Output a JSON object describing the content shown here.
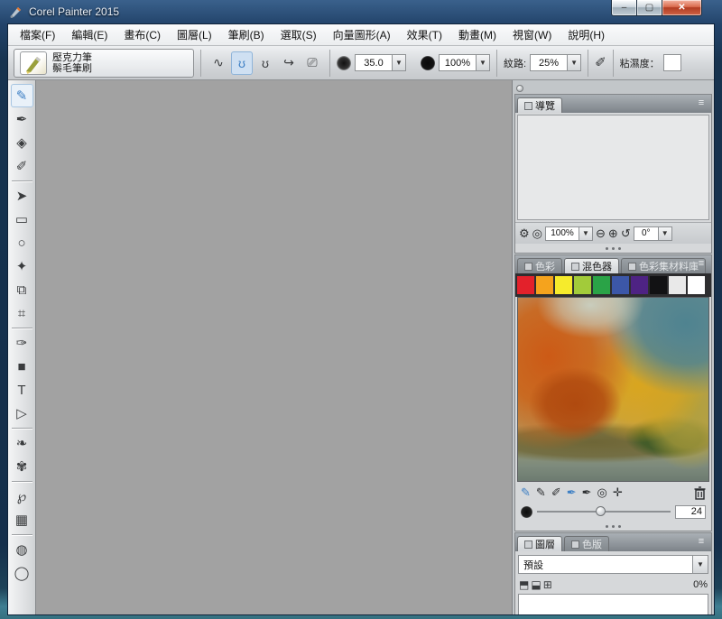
{
  "window": {
    "title": "Corel Painter 2015",
    "minimize_label": "–",
    "maximize_label": "▢",
    "close_label": "✕"
  },
  "menu_items": [
    {
      "name": "file",
      "label": "檔案(F)"
    },
    {
      "name": "edit",
      "label": "編輯(E)"
    },
    {
      "name": "canvas",
      "label": "畫布(C)"
    },
    {
      "name": "layers",
      "label": "圖層(L)"
    },
    {
      "name": "brushes",
      "label": "筆刷(B)"
    },
    {
      "name": "select",
      "label": "選取(S)"
    },
    {
      "name": "shapes",
      "label": "向量圖形(A)"
    },
    {
      "name": "effects",
      "label": "效果(T)"
    },
    {
      "name": "movie",
      "label": "動畫(M)"
    },
    {
      "name": "window",
      "label": "視窗(W)"
    },
    {
      "name": "help",
      "label": "說明(H)"
    }
  ],
  "property_bar": {
    "brush_category": "壓克力筆",
    "brush_variant": "鬃毛筆刷",
    "size_value": "35.0",
    "opacity_value": "100%",
    "grain_label": "紋路:",
    "grain_value": "25%",
    "viscosity_label": "粘濕度："
  },
  "stroke_buttons": [
    {
      "name": "freehand-stroke",
      "glyph": "∿",
      "selected": false
    },
    {
      "name": "loop-stroke-a",
      "glyph": "ʊ",
      "selected": true
    },
    {
      "name": "loop-stroke-b",
      "glyph": "ʊ",
      "selected": false
    },
    {
      "name": "align-to-path",
      "glyph": "↪",
      "selected": false
    },
    {
      "name": "perspective-guides",
      "glyph": "⎚",
      "selected": false
    }
  ],
  "toolbox": [
    {
      "type": "tool",
      "name": "brush-tool",
      "glyph": "✎",
      "selected": true
    },
    {
      "type": "tool",
      "name": "dropper-tool",
      "glyph": "✒",
      "selected": false
    },
    {
      "type": "tool",
      "name": "paint-bucket-tool",
      "glyph": "◈",
      "selected": false
    },
    {
      "type": "tool",
      "name": "eraser-tool",
      "glyph": "✐",
      "selected": false
    },
    {
      "type": "divider"
    },
    {
      "type": "tool",
      "name": "layer-adjuster-tool",
      "glyph": "➤",
      "selected": false
    },
    {
      "type": "tool",
      "name": "rectangular-selection-tool",
      "glyph": "▭",
      "selected": false
    },
    {
      "type": "tool",
      "name": "lasso-tool",
      "glyph": "○",
      "selected": false
    },
    {
      "type": "tool",
      "name": "magic-wand-tool",
      "glyph": "✦",
      "selected": false
    },
    {
      "type": "tool",
      "name": "transform-tool",
      "glyph": "⧉",
      "selected": false
    },
    {
      "type": "tool",
      "name": "crop-tool",
      "glyph": "⌗",
      "selected": false
    },
    {
      "type": "divider"
    },
    {
      "type": "tool",
      "name": "pen-tool",
      "glyph": "✑",
      "selected": false
    },
    {
      "type": "tool",
      "name": "rectangular-shape-tool",
      "glyph": "■",
      "selected": false
    },
    {
      "type": "tool",
      "name": "text-tool",
      "glyph": "T",
      "selected": false
    },
    {
      "type": "tool",
      "name": "shape-selection-tool",
      "glyph": "▷",
      "selected": false
    },
    {
      "type": "divider"
    },
    {
      "type": "tool",
      "name": "mirror-painting-tool",
      "glyph": "❧",
      "selected": false
    },
    {
      "type": "tool",
      "name": "kaleidoscope-tool",
      "glyph": "✾",
      "selected": false
    },
    {
      "type": "divider"
    },
    {
      "type": "tool",
      "name": "divine-proportion-tool",
      "glyph": "℘",
      "selected": false
    },
    {
      "type": "tool",
      "name": "layout-grid-tool",
      "glyph": "▦",
      "selected": false
    },
    {
      "type": "divider"
    },
    {
      "type": "tool",
      "name": "magnifier-tool",
      "glyph": "◍",
      "selected": false
    },
    {
      "type": "tool",
      "name": "grabber-tool",
      "glyph": "◯",
      "selected": false
    }
  ],
  "navigator": {
    "tab_label": "導覽",
    "zoom_value": "100%",
    "rotation_value": "0°",
    "icons": {
      "settings": "⚙",
      "magnifier": "◎",
      "zoom_out": "⊖",
      "zoom_in": "⊕",
      "rotate": "↺"
    }
  },
  "color_panel": {
    "tabs": [
      {
        "name": "color",
        "label": "色彩",
        "active": false
      },
      {
        "name": "mixer",
        "label": "混色器",
        "active": true
      },
      {
        "name": "color-set-library",
        "label": "色彩集材料庫",
        "active": false
      }
    ],
    "swatches": [
      "#e3212b",
      "#f5a31d",
      "#f6eb2c",
      "#a2cb3a",
      "#2aa347",
      "#3c57a8",
      "#4e2383",
      "#121214",
      "#e9e9e9",
      "#ffffff"
    ],
    "mixer_tools": [
      {
        "name": "dirty-brush-mode-icon",
        "glyph": "✎",
        "blue": true
      },
      {
        "name": "apply-color-icon",
        "glyph": "✎",
        "blue": false
      },
      {
        "name": "mix-color-icon",
        "glyph": "✐",
        "blue": false
      },
      {
        "name": "sample-color-icon",
        "glyph": "✒",
        "blue": true
      },
      {
        "name": "sample-multiple-colors-icon",
        "glyph": "✒",
        "blue": false
      },
      {
        "name": "zoom-mixer-icon",
        "glyph": "◎",
        "blue": false
      },
      {
        "name": "pan-mixer-icon",
        "glyph": "✛",
        "blue": false
      }
    ],
    "slider_value": "24"
  },
  "layers_panel": {
    "tabs": [
      {
        "name": "layers",
        "label": "圖層",
        "active": true
      },
      {
        "name": "channels",
        "label": "色版",
        "active": false
      }
    ],
    "preset_value": "預設",
    "opacity_value": "0%",
    "blend_icons": [
      {
        "name": "preserve-transparency-icon",
        "glyph": "⬒"
      },
      {
        "name": "pick-up-underlying-color-icon",
        "glyph": "⬓"
      },
      {
        "name": "layer-link-icon",
        "glyph": "⊞"
      }
    ]
  }
}
